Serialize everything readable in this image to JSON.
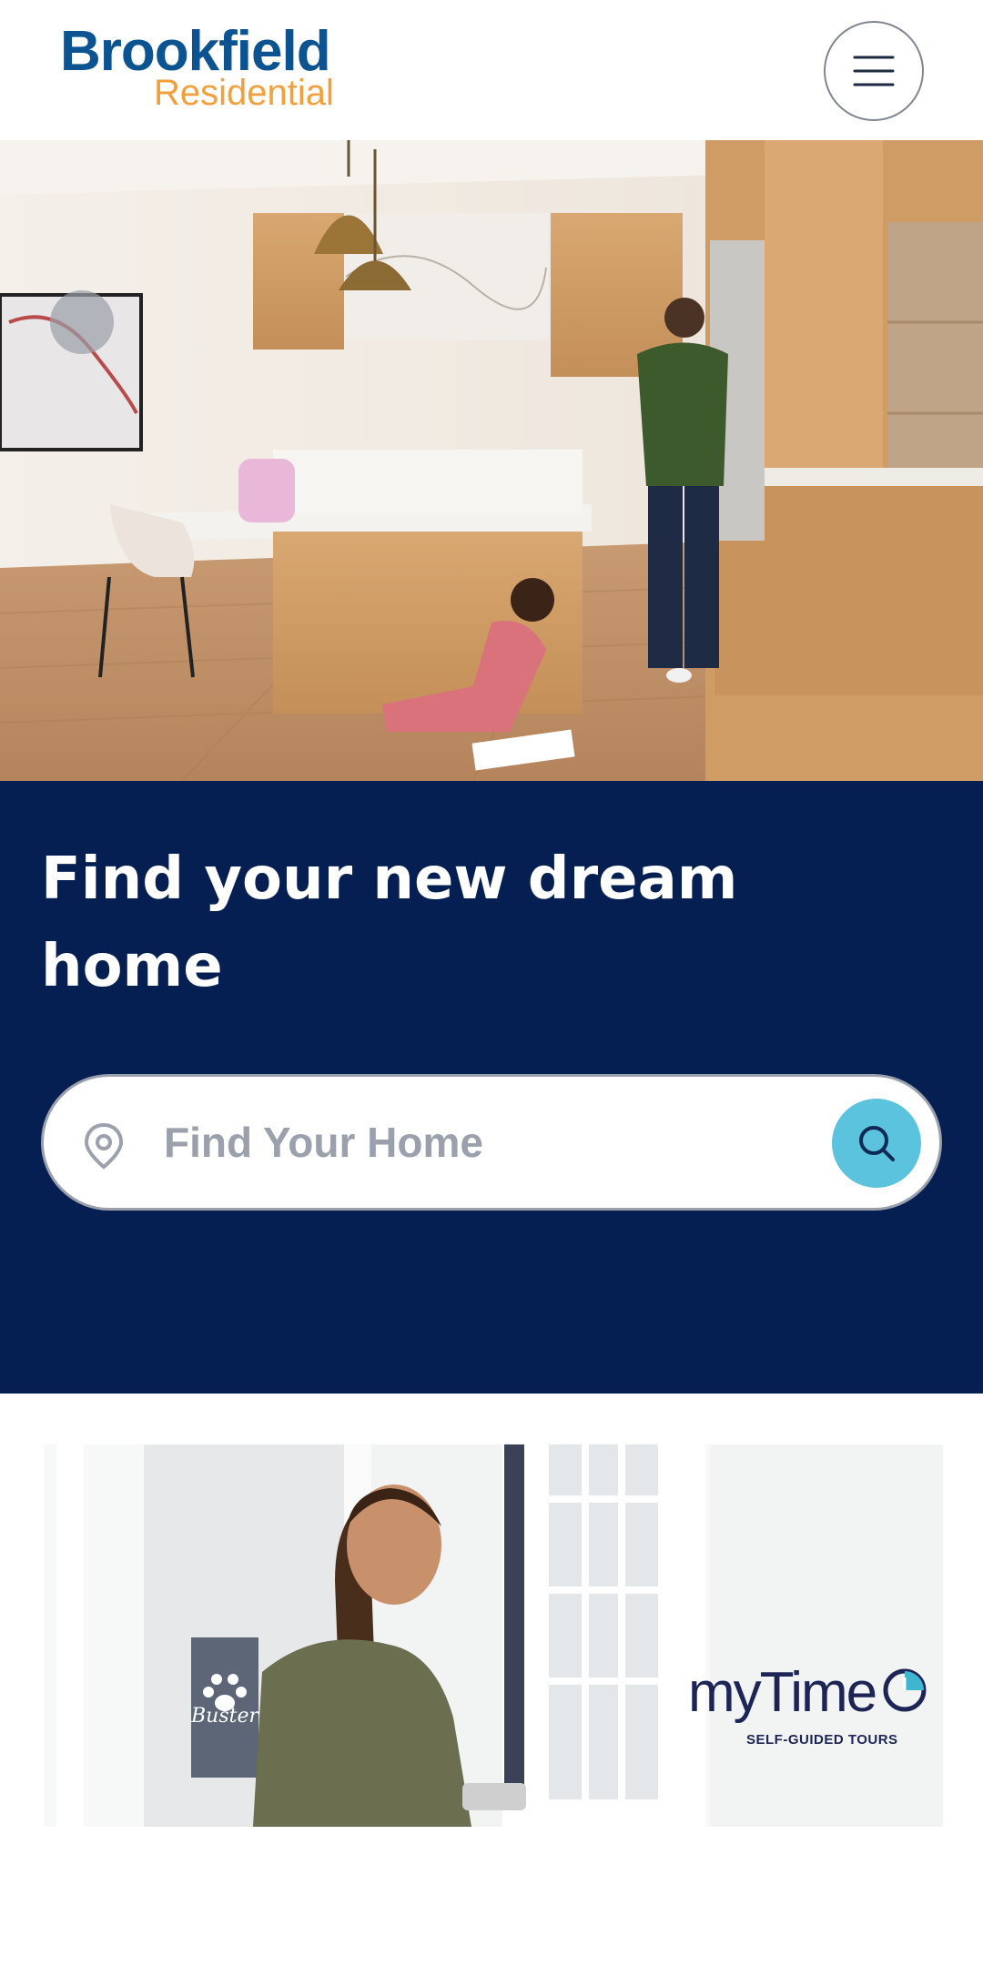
{
  "header": {
    "logo_top": "Brookfield",
    "logo_bottom": "Residential",
    "menu_icon": "hamburger-menu-icon",
    "brand_blue": "#0c5391",
    "brand_orange": "#f2a03c"
  },
  "hero": {
    "image": "kitchen-family-photo"
  },
  "search_section": {
    "headline": "Find your new dream home",
    "search_placeholder": "Find Your Home",
    "pin_icon": "location-pin-icon",
    "search_icon": "search-icon",
    "background": "#051f52",
    "accent": "#5bc3de"
  },
  "promo": {
    "image": "woman-at-door-photo",
    "brand": "myTime",
    "subtitle": "SELF-GUIDED TOURS",
    "door_sign": "Buster"
  }
}
